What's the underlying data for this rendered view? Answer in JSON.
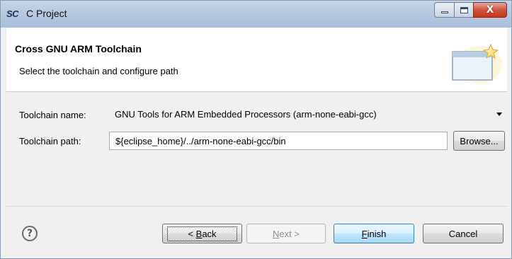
{
  "window": {
    "app_icon": "SC",
    "title": "C Project",
    "controls": {
      "minimize_icon": "minimize-icon",
      "maximize_icon": "maximize-icon",
      "close_glyph": "X"
    }
  },
  "header": {
    "title": "Cross GNU ARM Toolchain",
    "subtitle": "Select the toolchain and configure path",
    "icon": "wizard-banner-icon"
  },
  "form": {
    "toolchain_name_label": "Toolchain name:",
    "toolchain_name_value": "GNU Tools for ARM Embedded Processors (arm-none-eabi-gcc)",
    "toolchain_path_label": "Toolchain path:",
    "toolchain_path_value": "${eclipse_home}/../arm-none-eabi-gcc/bin",
    "browse_label": "Browse..."
  },
  "footer": {
    "help_glyph": "?",
    "back_prefix": "< ",
    "back_mnemonic": "B",
    "back_rest": "ack",
    "next_mnemonic": "N",
    "next_rest": "ext >",
    "finish_mnemonic": "F",
    "finish_rest": "inish",
    "cancel_label": "Cancel"
  },
  "colors": {
    "titlebar": "#b6c9e2",
    "close_button": "#c13a22",
    "finish_button_border": "#3c7fb1",
    "dialog_bg": "#f0f0f0"
  }
}
